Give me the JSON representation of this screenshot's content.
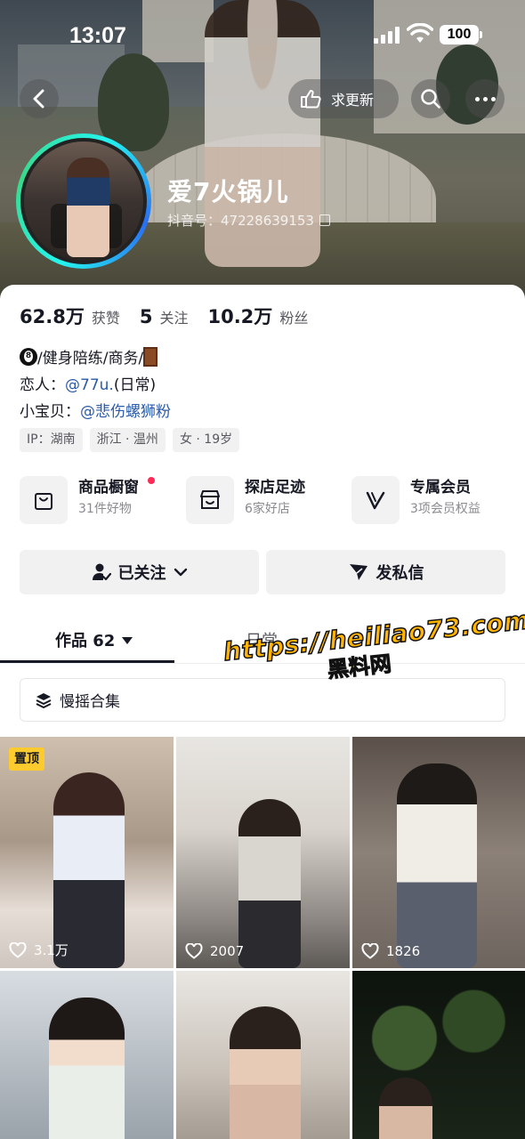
{
  "status_bar": {
    "time": "13:07",
    "battery": "100"
  },
  "top_nav": {
    "refresh_label": "求更新"
  },
  "profile": {
    "nickname": "爱7火锅儿",
    "douyin_id": "抖音号：47228639153"
  },
  "stats": [
    {
      "value": "62.8万",
      "label": "获赞"
    },
    {
      "value": "5",
      "label": "关注"
    },
    {
      "value": "10.2万",
      "label": "粉丝"
    }
  ],
  "bio": {
    "line1_text": "/健身陪练/商务/",
    "line2_prefix": "恋人：",
    "line2_mention": "@77u.",
    "line2_suffix": "(日常)",
    "line3_prefix": "小宝贝：",
    "line3_mention": "@悲伤螺狮粉"
  },
  "tags": [
    "IP：湖南",
    "浙江 · 温州",
    "女 · 19岁"
  ],
  "features": [
    {
      "title": "商品橱窗",
      "subtitle": "31件好物",
      "icon": "bag-icon",
      "has_dot": true
    },
    {
      "title": "探店足迹",
      "subtitle": "6家好店",
      "icon": "store-icon",
      "has_dot": false
    },
    {
      "title": "专属会员",
      "subtitle": "3项会员权益",
      "icon": "vip-icon",
      "has_dot": false
    }
  ],
  "buttons": {
    "following": "已关注",
    "message": "发私信"
  },
  "tabs": [
    {
      "label": "作品 62",
      "active": true
    },
    {
      "label": "日常",
      "active": false
    }
  ],
  "watermark": {
    "url": "https://heiliao73.com",
    "sub": "黑料网"
  },
  "collection": {
    "label": "慢摇合集"
  },
  "videos": [
    {
      "likes": "3.1万",
      "pinned": true,
      "pin_label": "置顶"
    },
    {
      "likes": "2007",
      "pinned": false
    },
    {
      "likes": "1826",
      "pinned": false
    },
    {
      "likes": "",
      "pinned": false
    },
    {
      "likes": "",
      "pinned": false
    },
    {
      "likes": "",
      "pinned": false
    }
  ],
  "colors": {
    "accent_red": "#fe2c55",
    "link_blue": "#2b5ba8",
    "pin_yellow": "#fecb2f",
    "watermark": "#ffb400"
  }
}
